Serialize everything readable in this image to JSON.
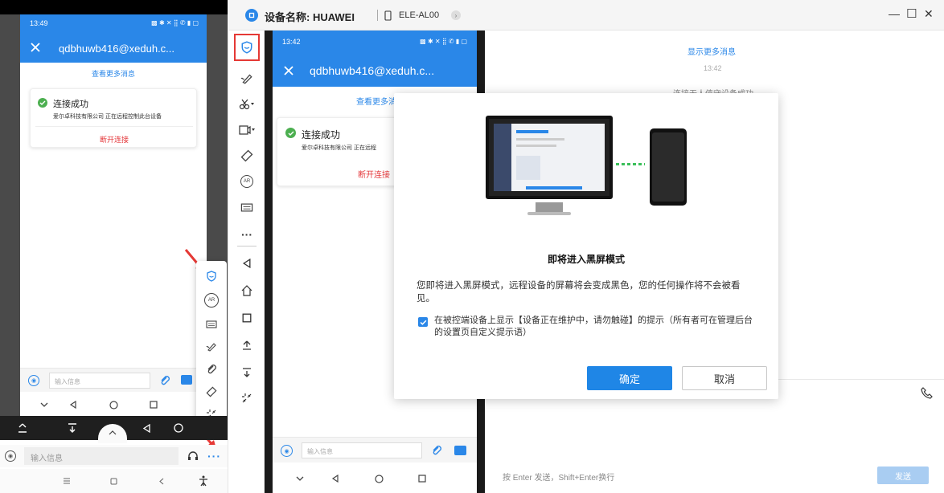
{
  "left_phone": {
    "status_time": "13:49",
    "status_icons": "▩ ✱ ✕ ⣿ ✆ ▮ ▢",
    "header_title": "qdbhuwb416@xeduh.c...",
    "more_messages": "查看更多消息",
    "connect_title": "连接成功",
    "connect_desc": "爱尔卓科技有限公司 正在远程控制此台设备",
    "disconnect": "断开连接",
    "input_placeholder": "输入信息",
    "bottom_input_placeholder": "输入信息"
  },
  "window": {
    "device_label": "设备名称: HUAWEI",
    "model": "ELE-AL00",
    "controls": {
      "minimize": "—",
      "maximize": "☐",
      "close": "✕"
    }
  },
  "mid_phone": {
    "status_time": "13:42",
    "status_icons": "▩ ✱ ✕ ⣿ ✆ ▮ ▢",
    "header_title": "qdbhuwb416@xeduh.c...",
    "more_messages": "查看更多消息",
    "connect_title": "连接成功",
    "connect_desc": "爱尔卓科技有限公司 正在远程",
    "disconnect": "断开连接",
    "input_placeholder": "输入信息"
  },
  "chat": {
    "show_more": "显示更多消息",
    "time": "13:42",
    "system_msg": "连接无人值守设备成功",
    "hint": "按 Enter 发送，Shift+Enter换行",
    "send": "发送"
  },
  "modal": {
    "title": "即将进入黑屏模式",
    "body": "您即将进入黑屏模式，远程设备的屏幕将会变成黑色，您的任何操作将不会被看见。",
    "checkbox_label": "在被控端设备上显示【设备正在维护中，请勿触碰】的提示（所有者可在管理后台的设置页自定义提示语）",
    "checkbox_checked": true,
    "ok": "确定",
    "cancel": "取消"
  },
  "colors": {
    "accent": "#2a87e8",
    "danger": "#e4393c",
    "highlight_border": "#e53935"
  }
}
